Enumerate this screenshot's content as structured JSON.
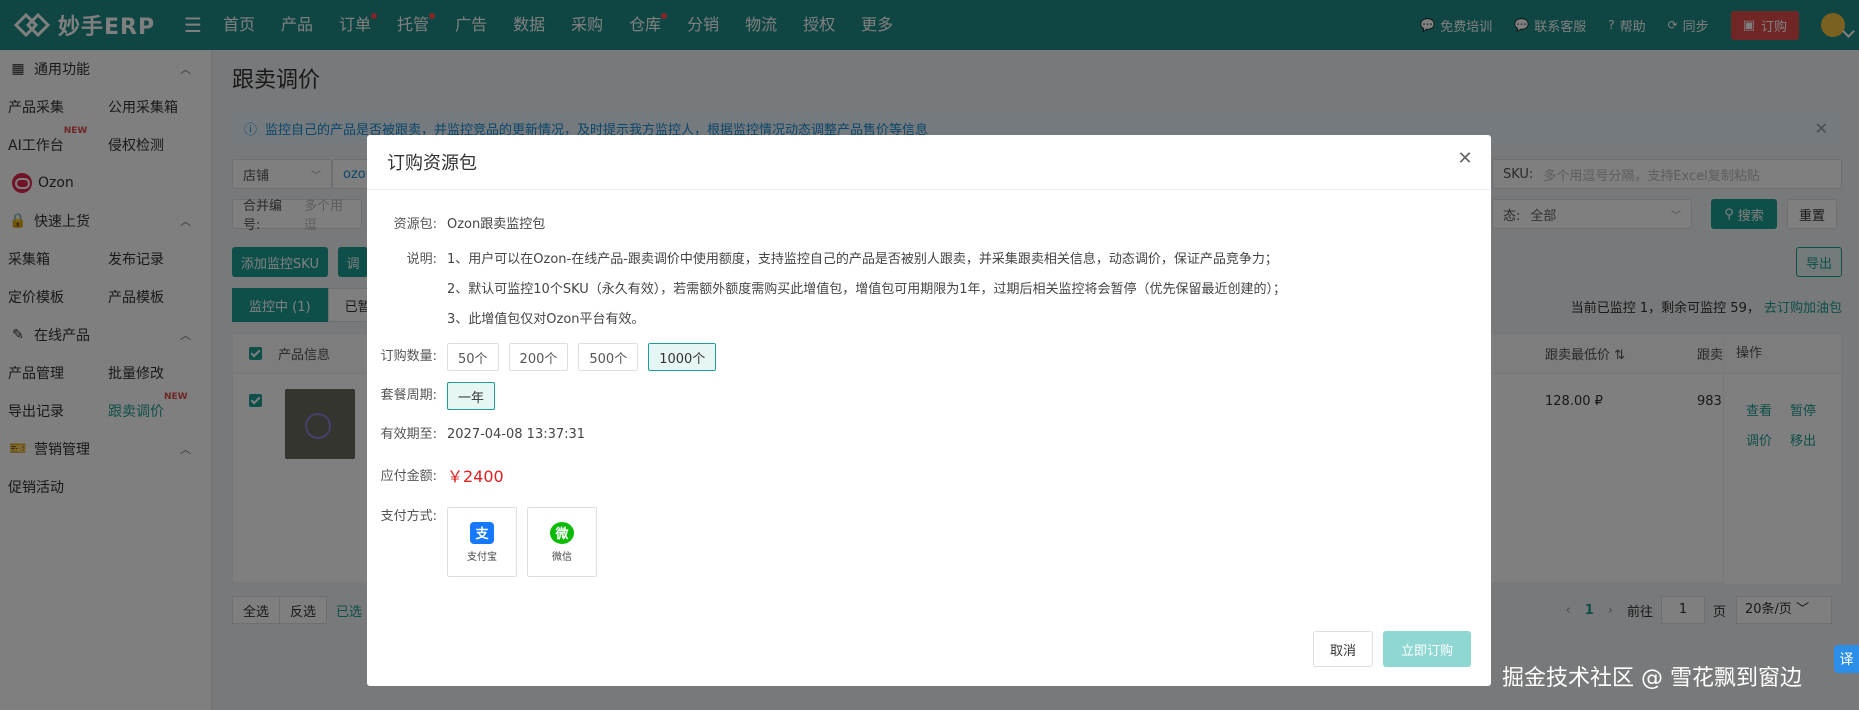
{
  "topbar": {
    "brand": "妙手ERP",
    "nav": [
      {
        "label": "首页",
        "dot": false
      },
      {
        "label": "产品",
        "dot": false
      },
      {
        "label": "订单",
        "dot": true
      },
      {
        "label": "托管",
        "dot": true
      },
      {
        "label": "广告",
        "dot": false
      },
      {
        "label": "数据",
        "dot": false
      },
      {
        "label": "采购",
        "dot": false
      },
      {
        "label": "仓库",
        "dot": true
      },
      {
        "label": "分销",
        "dot": false
      },
      {
        "label": "物流",
        "dot": false
      },
      {
        "label": "授权",
        "dot": false
      },
      {
        "label": "更多",
        "dot": false
      }
    ],
    "right": {
      "training": "免费培训",
      "contact": "联系客服",
      "help": "帮助",
      "sync": "同步",
      "order": "订购"
    }
  },
  "sidebar": {
    "groups": [
      {
        "title": "通用功能",
        "icon": "grid-icon",
        "items": [
          "产品采集",
          "公用采集箱",
          "AI工作台",
          "侵权检测"
        ]
      },
      {
        "title": "快速上货",
        "icon": "lock-icon",
        "items": [
          "采集箱",
          "发布记录",
          "定价模板",
          "产品模板"
        ]
      },
      {
        "title": "在线产品",
        "icon": "edit-icon",
        "items": [
          "产品管理",
          "批量修改",
          "导出记录",
          "跟卖调价"
        ]
      },
      {
        "title": "营销管理",
        "icon": "ticket-icon",
        "items": [
          "促销活动"
        ]
      }
    ],
    "ozon_label": "Ozon",
    "new_badge": "NEW",
    "active_item": "跟卖调价"
  },
  "main": {
    "title": "跟卖调价",
    "info": "监控自己的产品是否被跟卖，并监控竞品的更新情况，及时提示我方监控人，根据监控情况动态调整产品售价等信息",
    "filters": {
      "shop_label": "店铺",
      "shop_value": "ozon",
      "sku_label": "SKU:",
      "sku_placeholder": "多个用逗号分隔，支持Excel复制粘贴",
      "merge_label": "合并编号:",
      "merge_placeholder": "多个用逗",
      "status_label": "态:",
      "status_value": "全部"
    },
    "buttons": {
      "add_sku": "添加监控SKU",
      "adjust": "调",
      "search": "搜索",
      "reset": "重置",
      "export": "导出"
    },
    "tabs": [
      {
        "label": "监控中 (1)",
        "active": true
      },
      {
        "label": "已暂",
        "active": false
      }
    ],
    "monitor_status": "当前已监控 1，剩余可监控 59，",
    "monitor_link": "去订购加油包",
    "table": {
      "col_product": "产品信息",
      "col_min_price": "跟卖最低价",
      "col_other": "跟卖",
      "col_ops": "操作",
      "row_price": "128.00 ₽",
      "row_other": "983",
      "ops": [
        "查看",
        "暂停",
        "调价",
        "移出"
      ]
    },
    "bulk": {
      "select_all": "全选",
      "invert": "反选",
      "selected": "已选"
    },
    "pager": {
      "current_page": "1",
      "goto_label": "前往",
      "goto_value": "1",
      "page_unit": "页",
      "page_size": "20条/页"
    }
  },
  "modal": {
    "title": "订购资源包",
    "package_label": "资源包:",
    "package_value": "Ozon跟卖监控包",
    "desc_label": "说明:",
    "desc_lines": [
      "1、用户可以在Ozon-在线产品-跟卖调价中使用额度，支持监控自己的产品是否被别人跟卖，并采集跟卖相关信息，动态调价，保证产品竞争力；",
      "2、默认可监控10个SKU（永久有效），若需额外额度需购买此增值包，增值包可用期限为1年，过期后相关监控将会暂停（优先保留最近创建的）；",
      "3、此增值包仅对Ozon平台有效。"
    ],
    "qty_label": "订购数量:",
    "qty_options": [
      "50个",
      "200个",
      "500个",
      "1000个"
    ],
    "qty_selected": "1000个",
    "period_label": "套餐周期:",
    "period_options": [
      "一年"
    ],
    "expire_label": "有效期至:",
    "expire_value": "2027-04-08 13:37:31",
    "amount_label": "应付金额:",
    "amount_value": "￥2400",
    "pay_label": "支付方式:",
    "pay_methods": [
      {
        "name": "支付宝",
        "glyph": "支",
        "color": "#1677ff"
      },
      {
        "name": "微信",
        "glyph": "微",
        "color": "#09bb07"
      }
    ],
    "cancel": "取消",
    "confirm": "立即订购"
  },
  "watermark": "掘金技术社区 @ 雪花飘到窗边",
  "translate_chip": "译",
  "colors": {
    "brand": "#1f8c86",
    "accent": "#1f9e95",
    "danger": "#e34c4c",
    "price": "#e02020"
  }
}
